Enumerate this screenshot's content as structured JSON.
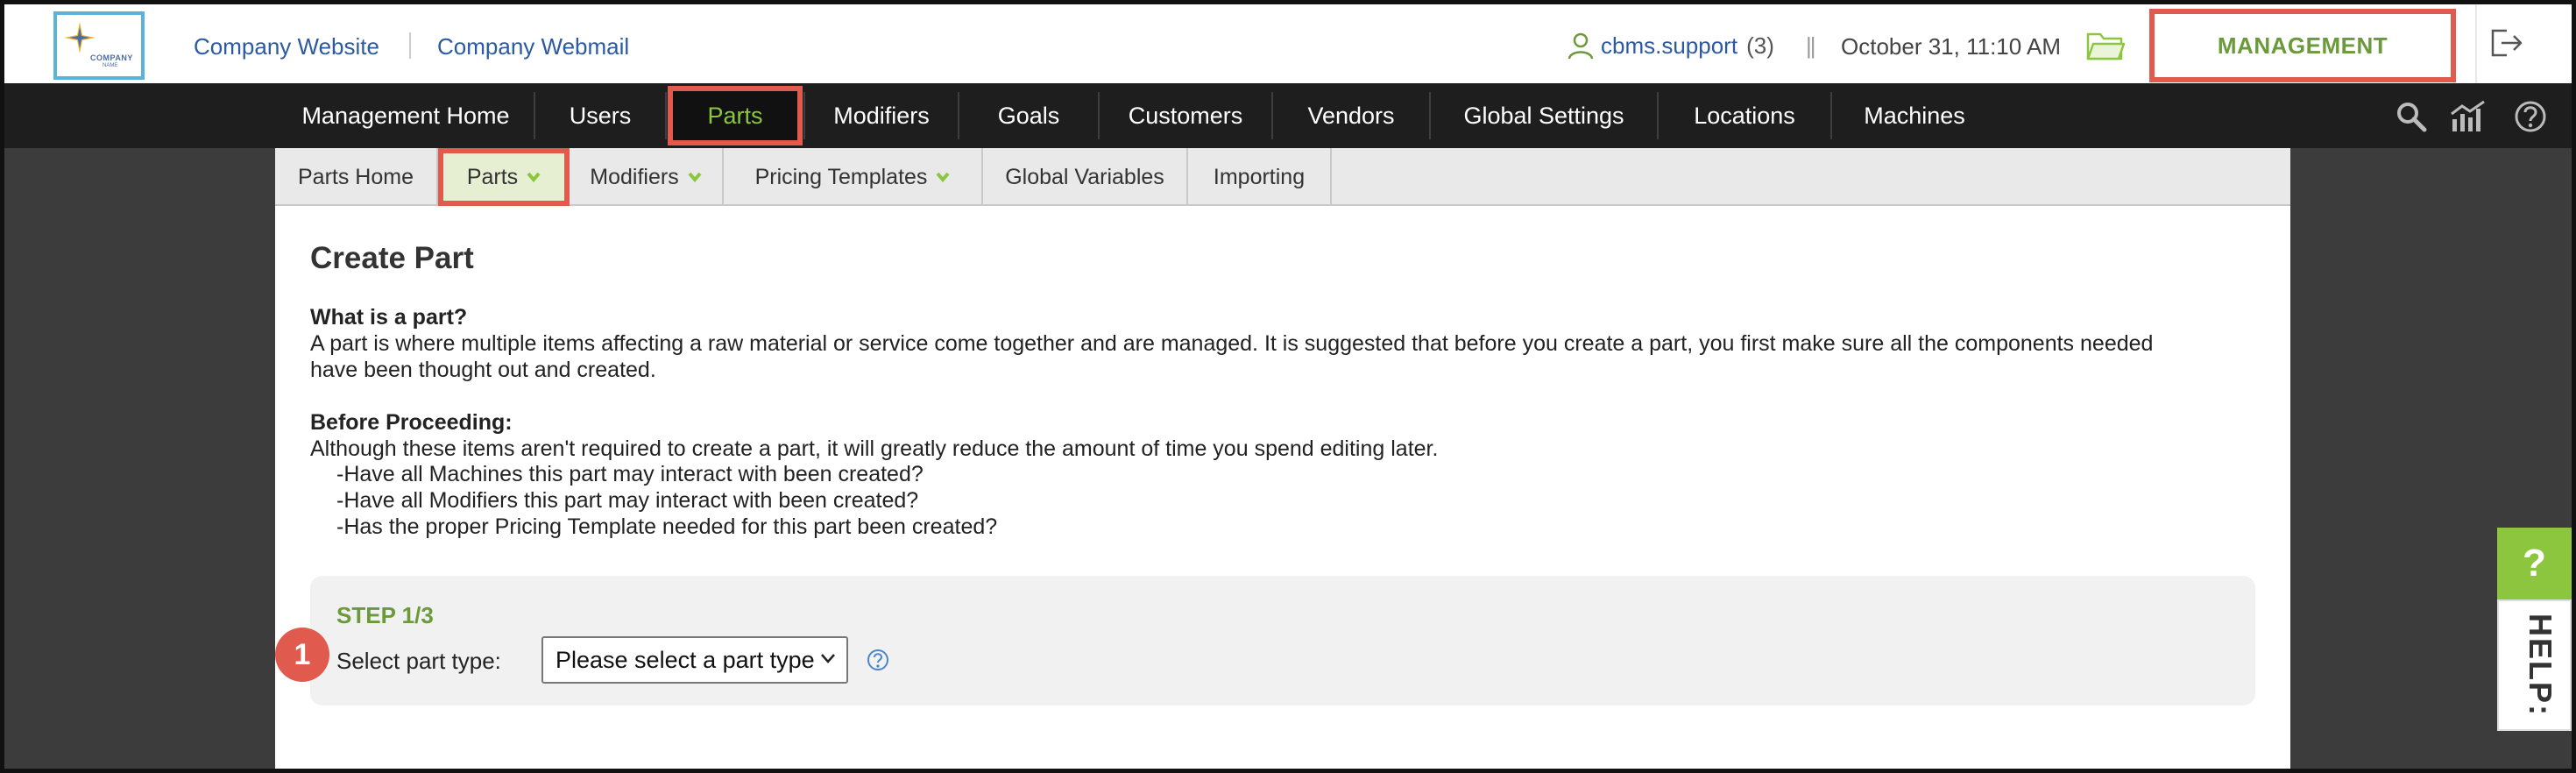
{
  "header": {
    "logo_text_1": "COMPANY",
    "logo_text_2": "NAME",
    "link_website": "Company Website",
    "link_webmail": "Company Webmail",
    "user_name": "cbms.support",
    "user_count": "(3)",
    "separator": "||",
    "datetime": "October 31, 11:10 AM",
    "management_label": "MANAGEMENT"
  },
  "main_nav": {
    "items": [
      {
        "label": "Management Home"
      },
      {
        "label": "Users"
      },
      {
        "label": "Parts"
      },
      {
        "label": "Modifiers"
      },
      {
        "label": "Goals"
      },
      {
        "label": "Customers"
      },
      {
        "label": "Vendors"
      },
      {
        "label": "Global Settings"
      },
      {
        "label": "Locations"
      },
      {
        "label": "Machines"
      }
    ],
    "active": "Parts"
  },
  "sub_nav": {
    "items": [
      {
        "label": "Parts Home"
      },
      {
        "label": "Parts"
      },
      {
        "label": "Modifiers"
      },
      {
        "label": "Pricing Templates"
      },
      {
        "label": "Global Variables"
      },
      {
        "label": "Importing"
      }
    ],
    "active": "Parts"
  },
  "content": {
    "title": "Create Part",
    "what_heading": "What is a part?",
    "what_line1": "A part is where multiple items affecting a raw material or service come together and are managed. It is suggested that before you create a part, you first make sure all the components needed",
    "what_line2": "have been thought out and created.",
    "before_heading": "Before Proceeding:",
    "before_text": "Although these items aren't required to create a part, it will greatly reduce the amount of time you spend editing later.",
    "checklist": [
      "-Have all Machines this part may interact with been created?",
      "-Have all Modifiers this part may interact with been created?",
      "-Has the proper Pricing Template needed for this part been created?"
    ]
  },
  "step": {
    "title": "STEP 1/3",
    "label": "Select part type:",
    "select_value": "Please select a part type",
    "badge": "1"
  },
  "help": {
    "q": "?",
    "label": "HELP:"
  },
  "colors": {
    "accent_green": "#8cc63f",
    "step_green": "#6a9a3a",
    "highlight_red": "#e05a4e",
    "link_blue": "#2c5aa0",
    "nav_bg": "#1e1e1e"
  }
}
